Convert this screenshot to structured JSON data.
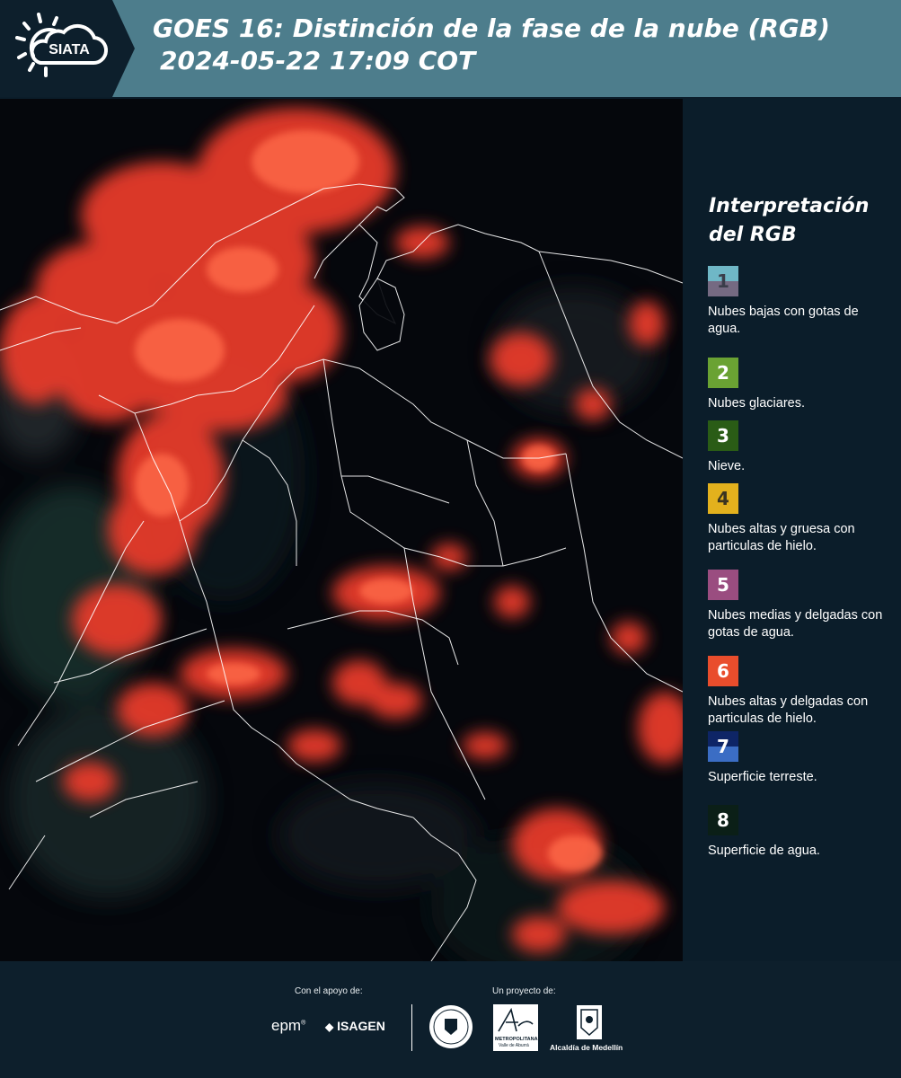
{
  "header": {
    "logo_text": "SIATA",
    "title_line1": "GOES 16: Distinción de la fase de la nube (RGB)",
    "title_line2": "2024-05-22 17:09 COT"
  },
  "legend": {
    "title_line1": "Interpretación",
    "title_line2": "del RGB",
    "items": [
      {
        "num": "1",
        "top_color": "#6fb7c6",
        "bottom_color": "#756a82",
        "label": "Nubes bajas con gotas de agua."
      },
      {
        "num": "2",
        "top_color": "#6aa233",
        "bottom_color": "#6aa233",
        "label": "Nubes glaciares."
      },
      {
        "num": "3",
        "top_color": "#2a5c16",
        "bottom_color": "#2a5c16",
        "label": "Nieve."
      },
      {
        "num": "4",
        "top_color": "#e3b11d",
        "bottom_color": "#e3b11d",
        "label": "Nubes altas y gruesa con particulas de hielo."
      },
      {
        "num": "5",
        "top_color": "#9a4d80",
        "bottom_color": "#9a4d80",
        "label": "Nubes medias y delgadas con gotas de agua."
      },
      {
        "num": "6",
        "top_color": "#e94d2c",
        "bottom_color": "#e94d2c",
        "label": "Nubes altas y delgadas con particulas de hielo."
      },
      {
        "num": "7",
        "top_color": "#0e2566",
        "bottom_color": "#3b6dc4",
        "label": "Superficie terreste."
      },
      {
        "num": "8",
        "top_color": "#0b1f17",
        "bottom_color": "#0b1f17",
        "label": "Superficie de agua."
      }
    ]
  },
  "footer": {
    "support_label": "Con el apoyo de:",
    "project_label": "Un proyecto de:",
    "sponsor_epm": "epm",
    "sponsor_isagen": "ISAGEN",
    "partner_area_line1": "METROPOLITANA",
    "partner_area_line2": "Valle de Aburrá",
    "partner_alcaldia": "Alcaldía de Medellín"
  }
}
